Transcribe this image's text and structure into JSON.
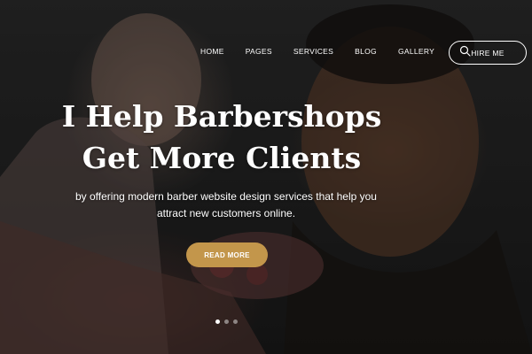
{
  "nav": {
    "items": [
      {
        "label": "HOME"
      },
      {
        "label": "PAGES"
      },
      {
        "label": "SERVICES"
      },
      {
        "label": "BLOG"
      },
      {
        "label": "GALLERY"
      }
    ],
    "search_icon": "search-icon",
    "hire_label": "HIRE ME"
  },
  "hero": {
    "heading_line1": "I Help Barbershops",
    "heading_line2": "Get More Clients",
    "subtext_line1": "by offering modern barber website design services that help you",
    "subtext_line2": "attract new customers online.",
    "cta_label": "READ MORE",
    "slider_dots": 3,
    "active_dot": 1
  },
  "colors": {
    "accent": "#c3964b",
    "text": "#ffffff",
    "background": "#1e1e1e"
  }
}
